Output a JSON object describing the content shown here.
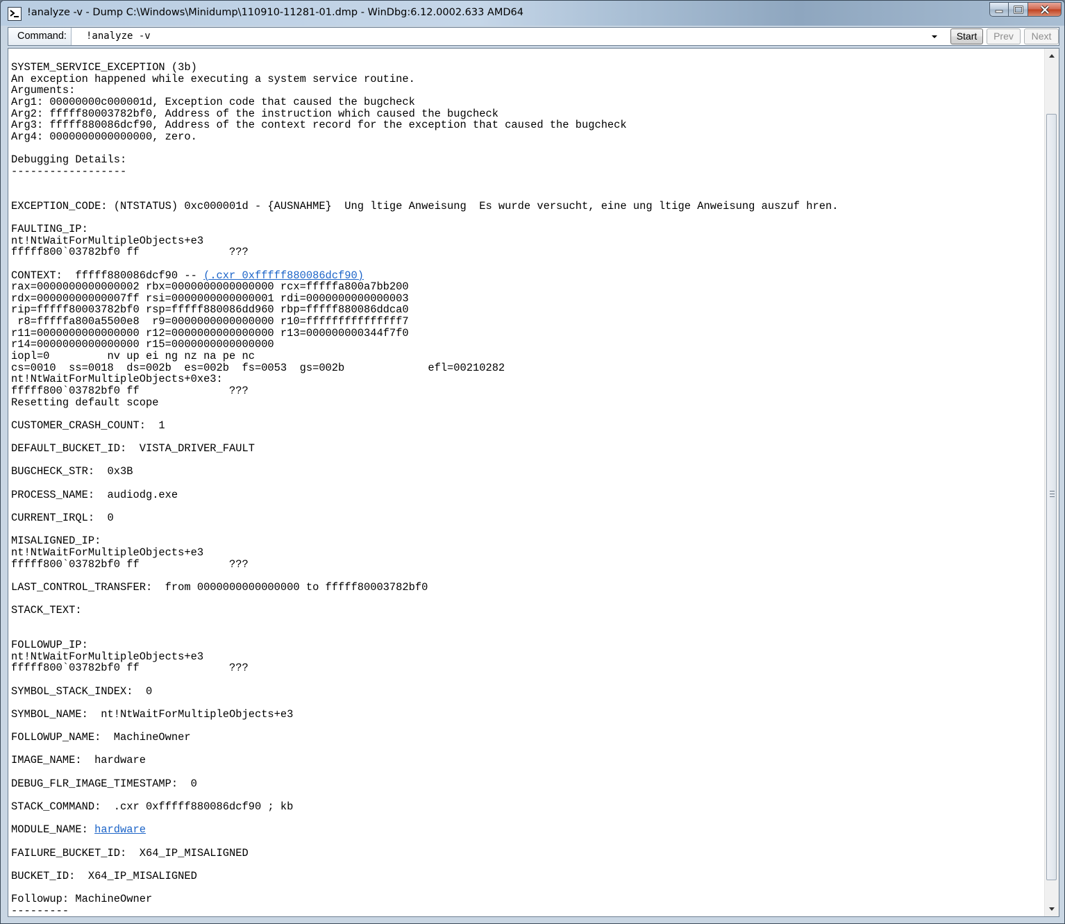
{
  "window": {
    "title": "!analyze -v - Dump C:\\Windows\\Minidump\\110910-11281-01.dmp - WinDbg:6.12.0002.633 AMD64"
  },
  "command_bar": {
    "label": "Command:",
    "value": "!analyze -v",
    "start_label": "Start",
    "prev_label": "Prev",
    "next_label": "Next"
  },
  "output": {
    "lines": [
      "SYSTEM_SERVICE_EXCEPTION (3b)",
      "An exception happened while executing a system service routine.",
      "Arguments:",
      "Arg1: 00000000c000001d, Exception code that caused the bugcheck",
      "Arg2: fffff80003782bf0, Address of the instruction which caused the bugcheck",
      "Arg3: fffff880086dcf90, Address of the context record for the exception that caused the bugcheck",
      "Arg4: 0000000000000000, zero.",
      "",
      "Debugging Details:",
      "------------------",
      "",
      "",
      "EXCEPTION_CODE: (NTSTATUS) 0xc000001d - {AUSNAHME}  Ung ltige Anweisung  Es wurde versucht, eine ung ltige Anweisung auszuf hren.",
      "",
      "FAULTING_IP:",
      "nt!NtWaitForMultipleObjects+e3",
      "fffff800`03782bf0 ff              ???",
      "",
      "CONTEXT:  fffff880086dcf90 -- ",
      "rax=0000000000000002 rbx=0000000000000000 rcx=fffffa800a7bb200",
      "rdx=00000000000007ff rsi=0000000000000001 rdi=0000000000000003",
      "rip=fffff80003782bf0 rsp=fffff880086dd960 rbp=fffff880086ddca0",
      " r8=fffffa800a5500e8  r9=0000000000000000 r10=fffffffffffffff7",
      "r11=0000000000000000 r12=0000000000000000 r13=000000000344f7f0",
      "r14=0000000000000000 r15=0000000000000000",
      "iopl=0         nv up ei ng nz na pe nc",
      "cs=0010  ss=0018  ds=002b  es=002b  fs=0053  gs=002b             efl=00210282",
      "nt!NtWaitForMultipleObjects+0xe3:",
      "fffff800`03782bf0 ff              ???",
      "Resetting default scope",
      "",
      "CUSTOMER_CRASH_COUNT:  1",
      "",
      "DEFAULT_BUCKET_ID:  VISTA_DRIVER_FAULT",
      "",
      "BUGCHECK_STR:  0x3B",
      "",
      "PROCESS_NAME:  audiodg.exe",
      "",
      "CURRENT_IRQL:  0",
      "",
      "MISALIGNED_IP:",
      "nt!NtWaitForMultipleObjects+e3",
      "fffff800`03782bf0 ff              ???",
      "",
      "LAST_CONTROL_TRANSFER:  from 0000000000000000 to fffff80003782bf0",
      "",
      "STACK_TEXT:",
      "",
      "",
      "FOLLOWUP_IP:",
      "nt!NtWaitForMultipleObjects+e3",
      "fffff800`03782bf0 ff              ???",
      "",
      "SYMBOL_STACK_INDEX:  0",
      "",
      "SYMBOL_NAME:  nt!NtWaitForMultipleObjects+e3",
      "",
      "FOLLOWUP_NAME:  MachineOwner",
      "",
      "IMAGE_NAME:  hardware",
      "",
      "DEBUG_FLR_IMAGE_TIMESTAMP:  0",
      "",
      "STACK_COMMAND:  .cxr 0xfffff880086dcf90 ; kb",
      "",
      "MODULE_NAME: ",
      "",
      "FAILURE_BUCKET_ID:  X64_IP_MISALIGNED",
      "",
      "BUCKET_ID:  X64_IP_MISALIGNED",
      "",
      "Followup: MachineOwner",
      "---------"
    ],
    "context_link": "(.cxr 0xfffff880086dcf90)",
    "module_link": "hardware",
    "link_color": "#1c64c8"
  }
}
